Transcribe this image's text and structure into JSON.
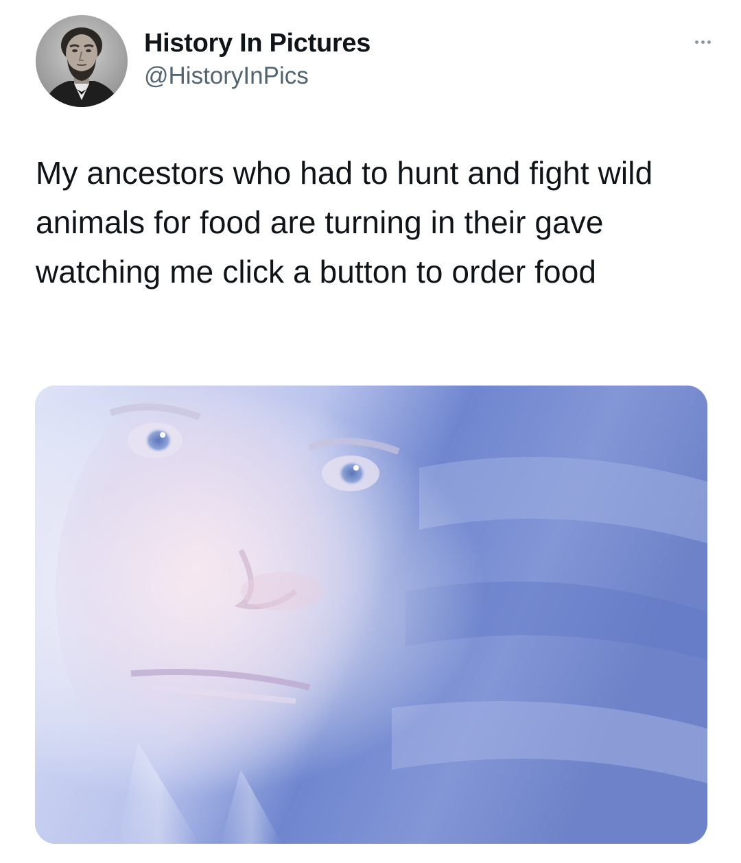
{
  "tweet": {
    "author": {
      "display_name": "History In Pictures",
      "handle": "@HistoryInPics"
    },
    "text": "My ancestors who had to hunt and fight wild animals for food are turning in their gave watching me click a button to order food",
    "more_icon": "more-horizontal-icon",
    "media": {
      "type": "image",
      "subject": "ghostly face in clouds"
    }
  },
  "colors": {
    "text_primary": "#0f1419",
    "text_secondary": "#536471",
    "background": "#ffffff"
  }
}
